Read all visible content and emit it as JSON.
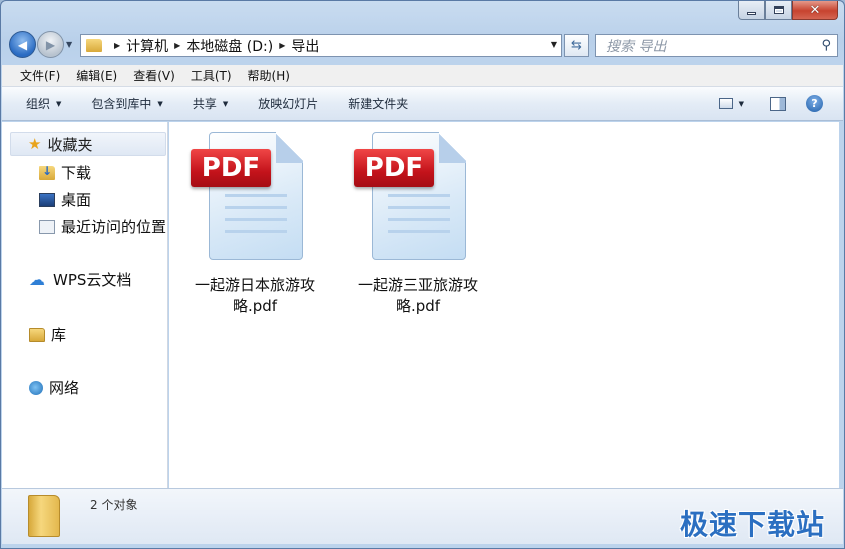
{
  "window": {
    "minimize_glyph": "",
    "maximize_glyph": "",
    "close_glyph": "✕"
  },
  "navigation": {
    "back_icon": "back-arrow-icon",
    "forward_icon": "forward-arrow-icon"
  },
  "address": {
    "crumbs": [
      "计算机",
      "本地磁盘 (D:)",
      "导出"
    ]
  },
  "search": {
    "placeholder": "搜索 导出"
  },
  "menubar": {
    "items": [
      "文件(F)",
      "编辑(E)",
      "查看(V)",
      "工具(T)",
      "帮助(H)"
    ]
  },
  "commandbar": {
    "items": [
      "组织",
      "包含到库中",
      "共享",
      "放映幻灯片",
      "新建文件夹"
    ]
  },
  "sidebar": {
    "favorites": "收藏夹",
    "items": [
      "下载",
      "桌面",
      "最近访问的位置"
    ],
    "wps": "WPS云文档",
    "library": "库",
    "network": "网络"
  },
  "files": [
    {
      "tag": "PDF",
      "name": "一起游日本旅游攻略.pdf"
    },
    {
      "tag": "PDF",
      "name": "一起游三亚旅游攻略.pdf"
    }
  ],
  "status": {
    "count": "2 个对象"
  },
  "watermark": "极速下载站",
  "colors": {
    "pdf_red": "#c4131b",
    "accent_blue": "#2b6fc1"
  }
}
